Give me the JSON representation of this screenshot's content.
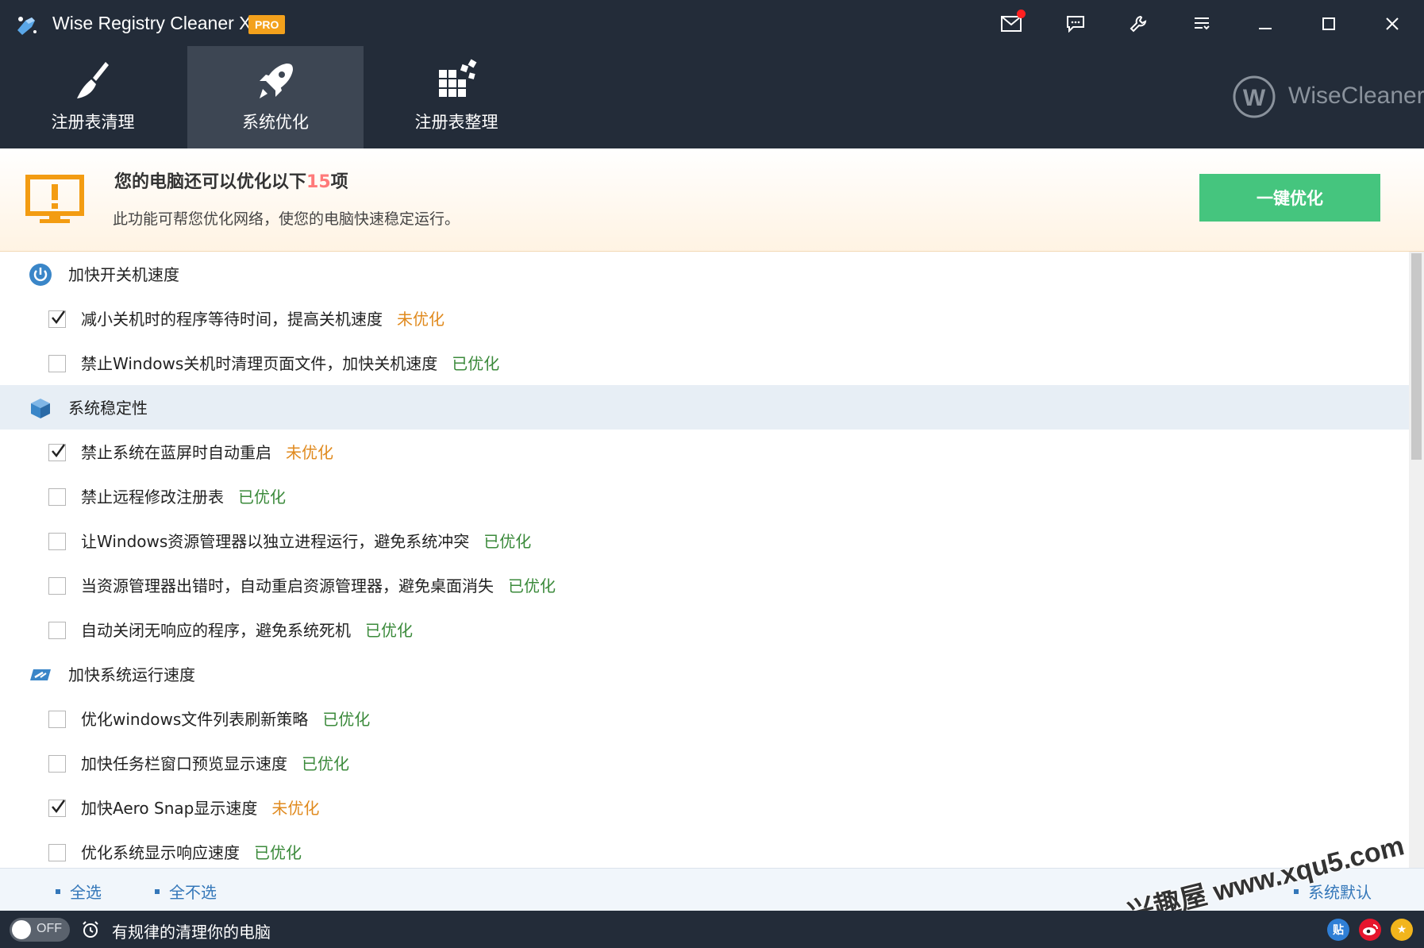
{
  "window": {
    "title": "Wise Registry Cleaner X",
    "badge": "PRO",
    "brand": "WiseCleaner"
  },
  "tabs": [
    {
      "label": "注册表清理",
      "active": false,
      "icon": "broom-icon"
    },
    {
      "label": "系统优化",
      "active": true,
      "icon": "rocket-icon"
    },
    {
      "label": "注册表整理",
      "active": false,
      "icon": "blocks-icon"
    }
  ],
  "banner": {
    "title_prefix": "您的电脑还可以优化以下",
    "count": "15",
    "title_suffix": "项",
    "description": "此功能可帮您优化网络，使您的电脑快速稳定运行。",
    "button_label": "一键优化"
  },
  "categories": [
    {
      "label": "加快开关机速度",
      "icon": "power-icon",
      "items": [
        {
          "text": "减小关机时的程序等待时间，提高关机速度",
          "status": "未优化",
          "checked": true
        },
        {
          "text": "禁止Windows关机时清理页面文件，加快关机速度",
          "status": "已优化",
          "checked": false
        }
      ]
    },
    {
      "label": "系统稳定性",
      "icon": "cube-icon",
      "items": [
        {
          "text": "禁止系统在蓝屏时自动重启",
          "status": "未优化",
          "checked": true
        },
        {
          "text": "禁止远程修改注册表",
          "status": "已优化",
          "checked": false
        },
        {
          "text": "让Windows资源管理器以独立进程运行，避免系统冲突",
          "status": "已优化",
          "checked": false
        },
        {
          "text": "当资源管理器出错时，自动重启资源管理器，避免桌面消失",
          "status": "已优化",
          "checked": false
        },
        {
          "text": "自动关闭无响应的程序，避免系统死机",
          "status": "已优化",
          "checked": false
        }
      ]
    },
    {
      "label": "加快系统运行速度",
      "icon": "speed-icon",
      "items": [
        {
          "text": "优化windows文件列表刷新策略",
          "status": "已优化",
          "checked": false
        },
        {
          "text": "加快任务栏窗口预览显示速度",
          "status": "已优化",
          "checked": false
        },
        {
          "text": "加快Aero Snap显示速度",
          "status": "未优化",
          "checked": true
        },
        {
          "text": "优化系统显示响应速度",
          "status": "已优化",
          "checked": false
        }
      ]
    }
  ],
  "selection": {
    "select_all": "全选",
    "select_none": "全不选",
    "system_default": "系统默认"
  },
  "watermark": "兴趣屋 www.xqu5.com",
  "statusbar": {
    "toggle_label": "OFF",
    "schedule_text": "有规律的清理你的电脑",
    "social": [
      {
        "label": "贴",
        "color": "#2f7fd6",
        "icon": "tieba-icon"
      },
      {
        "label": "",
        "color": "#e6162d",
        "icon": "weibo-icon"
      },
      {
        "label": "★",
        "color": "#f2b51c",
        "icon": "qzone-icon"
      }
    ]
  },
  "colors": {
    "header_bg": "#232c39",
    "active_tab_bg": "#3d4653",
    "button_green": "#45c57e",
    "status_pending": "#e08a1e",
    "status_done": "#3b8a3b",
    "link_blue": "#3477b9"
  }
}
